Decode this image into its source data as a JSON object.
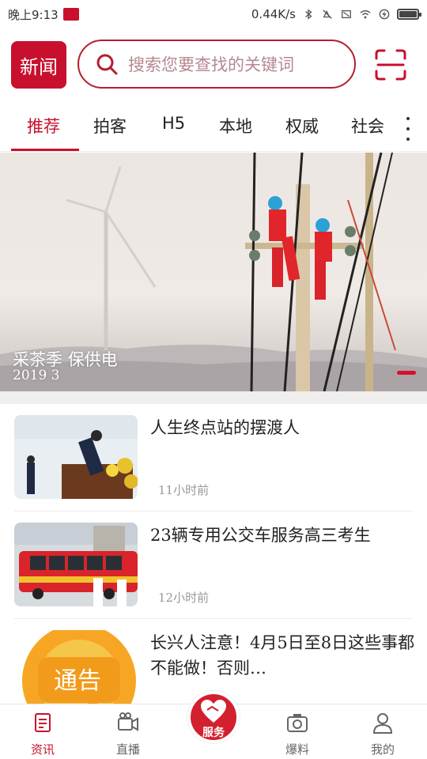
{
  "status_bar": {
    "time": "晚上9:13",
    "network_speed": "0.44K/s",
    "battery_percent": 100
  },
  "header": {
    "logo_text": "新闻",
    "search_placeholder": "搜索您要查找的关键词",
    "scan_icon": "scan-icon"
  },
  "tabs": [
    {
      "label": "推荐",
      "active": true
    },
    {
      "label": "拍客",
      "active": false
    },
    {
      "label": "H5",
      "active": false
    },
    {
      "label": "本地",
      "active": false
    },
    {
      "label": "权威",
      "active": false
    },
    {
      "label": "社会",
      "active": false
    }
  ],
  "banner": {
    "caption": "采茶季  保供电",
    "date": "2019  3",
    "current_slide": 1
  },
  "news": [
    {
      "title": "人生终点站的摆渡人",
      "time": "11小时前"
    },
    {
      "title": "23辆专用公交车服务高三考生",
      "time": "12小时前"
    },
    {
      "title": "长兴人注意！4月5日至8日这些事都不能做！否则…",
      "time": "",
      "thumb_text": "通告"
    }
  ],
  "bottom_nav": [
    {
      "label": "资讯",
      "icon": "news-icon",
      "active": true
    },
    {
      "label": "直播",
      "icon": "video-camera-icon",
      "active": false
    },
    {
      "label": "服务",
      "icon": "heart-icon",
      "active": false
    },
    {
      "label": "爆料",
      "icon": "camera-icon",
      "active": false
    },
    {
      "label": "我的",
      "icon": "user-icon",
      "active": false
    }
  ],
  "colors": {
    "brand_red": "#c8102e",
    "muted_text": "#999999"
  }
}
